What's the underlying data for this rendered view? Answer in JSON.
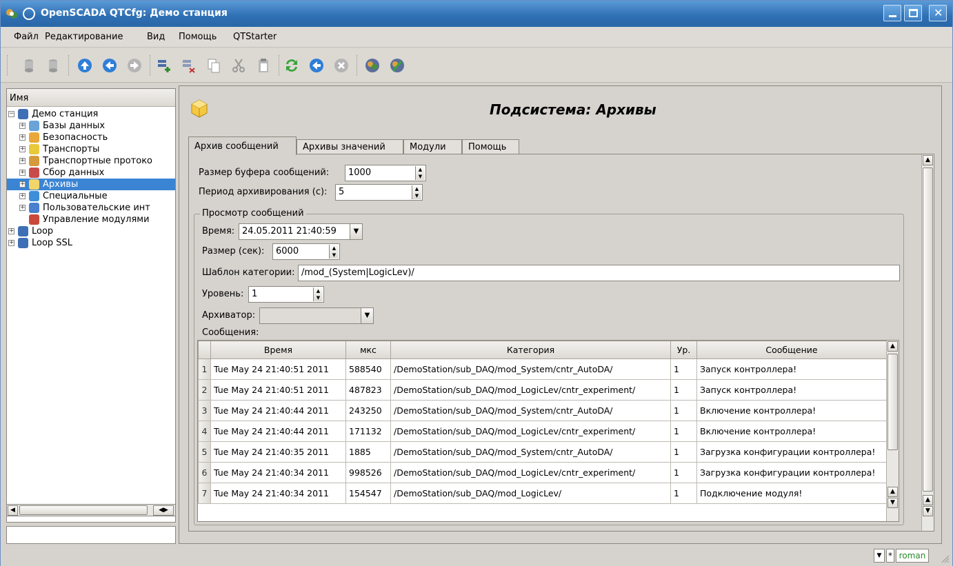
{
  "window": {
    "title": "OpenSCADA QTCfg: Демо станция",
    "accent": "#2e6fb3"
  },
  "menu": {
    "items": [
      "Файл",
      "Редактирование",
      "Вид",
      "Помощь",
      "QTStarter"
    ]
  },
  "toolbar": {
    "buttons": [
      "db-load-icon",
      "db-save-icon",
      "up-icon",
      "back-icon",
      "forward-icon",
      "add-item-icon",
      "delete-item-icon",
      "copy-icon",
      "cut-icon",
      "paste-icon",
      "refresh-icon",
      "start-icon",
      "stop-icon",
      "station-icon",
      "user-icon"
    ]
  },
  "tree": {
    "header": "Имя",
    "nodes": [
      {
        "label": "Демо станция",
        "level": 0,
        "exp": "−"
      },
      {
        "label": "Базы данных",
        "level": 1,
        "exp": "+"
      },
      {
        "label": "Безопасность",
        "level": 1,
        "exp": "+"
      },
      {
        "label": "Транспорты",
        "level": 1,
        "exp": "+"
      },
      {
        "label": "Транспортные протоко",
        "level": 1,
        "exp": "+"
      },
      {
        "label": "Сбор данных",
        "level": 1,
        "exp": "+"
      },
      {
        "label": "Архивы",
        "level": 1,
        "exp": "+",
        "selected": true
      },
      {
        "label": "Специальные",
        "level": 1,
        "exp": "+"
      },
      {
        "label": "Пользовательские инт",
        "level": 1,
        "exp": "+"
      },
      {
        "label": "Управление модулями",
        "level": 1,
        "exp": ""
      },
      {
        "label": "Loop",
        "level": 0,
        "exp": "+"
      },
      {
        "label": "Loop SSL",
        "level": 0,
        "exp": "+"
      }
    ]
  },
  "page": {
    "title": "Подсистема: Архивы",
    "tabs": [
      "Архив сообщений",
      "Архивы значений",
      "Модули",
      "Помощь"
    ]
  },
  "form": {
    "buffer_label": "Размер буфера сообщений:",
    "buffer_value": "1000",
    "period_label": "Период архивирования (с):",
    "period_value": "5",
    "group_title": "Просмотр сообщений",
    "time_label": "Время:",
    "time_value": "24.05.2011 21:40:59",
    "size_label": "Размер (сек):",
    "size_value": "6000",
    "category_label": "Шаблон категории:",
    "category_value": "/mod_(System|LogicLev)/",
    "level_label": "Уровень:",
    "level_value": "1",
    "archiver_label": "Архиватор:",
    "archiver_value": "",
    "messages_label": "Сообщения:"
  },
  "table": {
    "columns": [
      "Время",
      "мкс",
      "Категория",
      "Ур.",
      "Сообщение"
    ],
    "rows": [
      [
        "1",
        "Tue May 24 21:40:51 2011",
        "588540",
        "/DemoStation/sub_DAQ/mod_System/cntr_AutoDA/",
        "1",
        "Запуск контроллера!"
      ],
      [
        "2",
        "Tue May 24 21:40:51 2011",
        "487823",
        "/DemoStation/sub_DAQ/mod_LogicLev/cntr_experiment/",
        "1",
        "Запуск контроллера!"
      ],
      [
        "3",
        "Tue May 24 21:40:44 2011",
        "243250",
        "/DemoStation/sub_DAQ/mod_System/cntr_AutoDA/",
        "1",
        "Включение контроллера!"
      ],
      [
        "4",
        "Tue May 24 21:40:44 2011",
        "171132",
        "/DemoStation/sub_DAQ/mod_LogicLev/cntr_experiment/",
        "1",
        "Включение контроллера!"
      ],
      [
        "5",
        "Tue May 24 21:40:35 2011",
        "1885",
        "/DemoStation/sub_DAQ/mod_System/cntr_AutoDA/",
        "1",
        "Загрузка конфигурации контроллера!"
      ],
      [
        "6",
        "Tue May 24 21:40:34 2011",
        "998526",
        "/DemoStation/sub_DAQ/mod_LogicLev/cntr_experiment/",
        "1",
        "Загрузка конфигурации контроллера!"
      ],
      [
        "7",
        "Tue May 24 21:40:34 2011",
        "154547",
        "/DemoStation/sub_DAQ/mod_LogicLev/",
        "1",
        "Подключение модуля!"
      ]
    ]
  },
  "status": {
    "modified": "*",
    "user": "roman",
    "user_color": "#2a8a2a"
  }
}
